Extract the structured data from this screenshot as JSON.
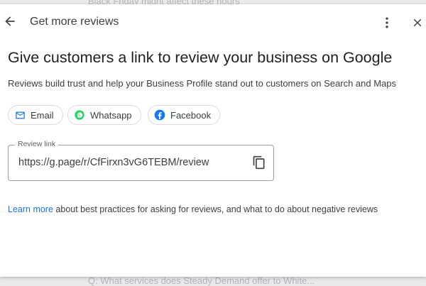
{
  "background": {
    "top_text": "Black Friday might affect these hours",
    "bottom_text": "Q: What services does Steady Demand offer to White..."
  },
  "header": {
    "title": "Get more reviews",
    "back_icon": "arrow-back-icon",
    "more_icon": "more-vert-icon",
    "close_icon": "close-icon"
  },
  "main": {
    "headline": "Give customers a link to review your business on Google",
    "subtitle": "Reviews build trust and help your Business Profile stand out to customers on Search and Maps",
    "share_chips": [
      {
        "label": "Email",
        "icon": "email-icon",
        "color": "#1a73e8"
      },
      {
        "label": "Whatsapp",
        "icon": "whatsapp-icon",
        "color": "#25d366"
      },
      {
        "label": "Facebook",
        "icon": "facebook-icon",
        "color": "#1877f2"
      }
    ],
    "review_link": {
      "label": "Review link",
      "value": "https://g.page/r/CfFirxn3vG6TEBM/review",
      "copy_icon": "copy-icon"
    },
    "learn_more": {
      "link_text": "Learn more",
      "rest_text": " about best practices for asking for reviews, and what to do about negative reviews"
    }
  },
  "colors": {
    "link_blue": "#1a73e8",
    "text_primary": "#202124",
    "text_secondary": "#3c4043",
    "border": "#dadce0"
  }
}
